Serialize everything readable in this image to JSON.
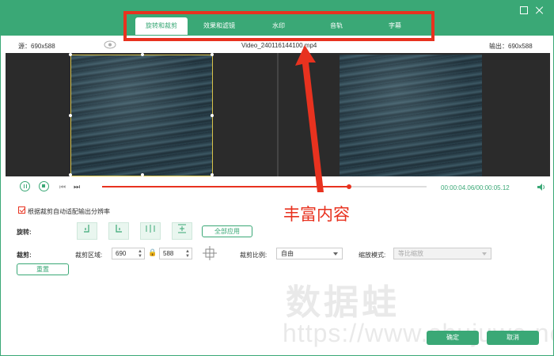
{
  "tabs": [
    {
      "label": "旋转和裁剪",
      "active": true
    },
    {
      "label": "效果和滤镜",
      "active": false
    },
    {
      "label": "水印",
      "active": false
    },
    {
      "label": "音轨",
      "active": false
    },
    {
      "label": "字幕",
      "active": false
    }
  ],
  "info": {
    "source": "源：690x588",
    "filename": "Video_240116144100.mp4",
    "output": "输出：690x588"
  },
  "annotation": {
    "text": "丰富内容",
    "color": "#e8321f"
  },
  "playback": {
    "timecode": "00:00:04.06/00:00:05.12",
    "progress": 0.76
  },
  "options": {
    "auto_resolution_label": "根据裁剪自动适配输出分辨率",
    "auto_resolution_checked": true
  },
  "rotate": {
    "label": "旋转:",
    "apply_all": "全部应用"
  },
  "crop": {
    "label": "裁剪:",
    "area_label": "裁剪区域:",
    "width": "690",
    "height": "588",
    "ratio_label": "裁剪比例:",
    "ratio_value": "自由",
    "zoom_label": "缩放模式:",
    "zoom_value": "等比缩放",
    "reset": "重置"
  },
  "footer": {
    "ok": "确定",
    "cancel": "取消"
  },
  "watermark": {
    "brand": "数据蛙",
    "url": "https://www.shujuwa.net"
  },
  "colors": {
    "accent": "#3aa876",
    "annotation": "#e8321f",
    "crop_border": "#d8c24a"
  }
}
